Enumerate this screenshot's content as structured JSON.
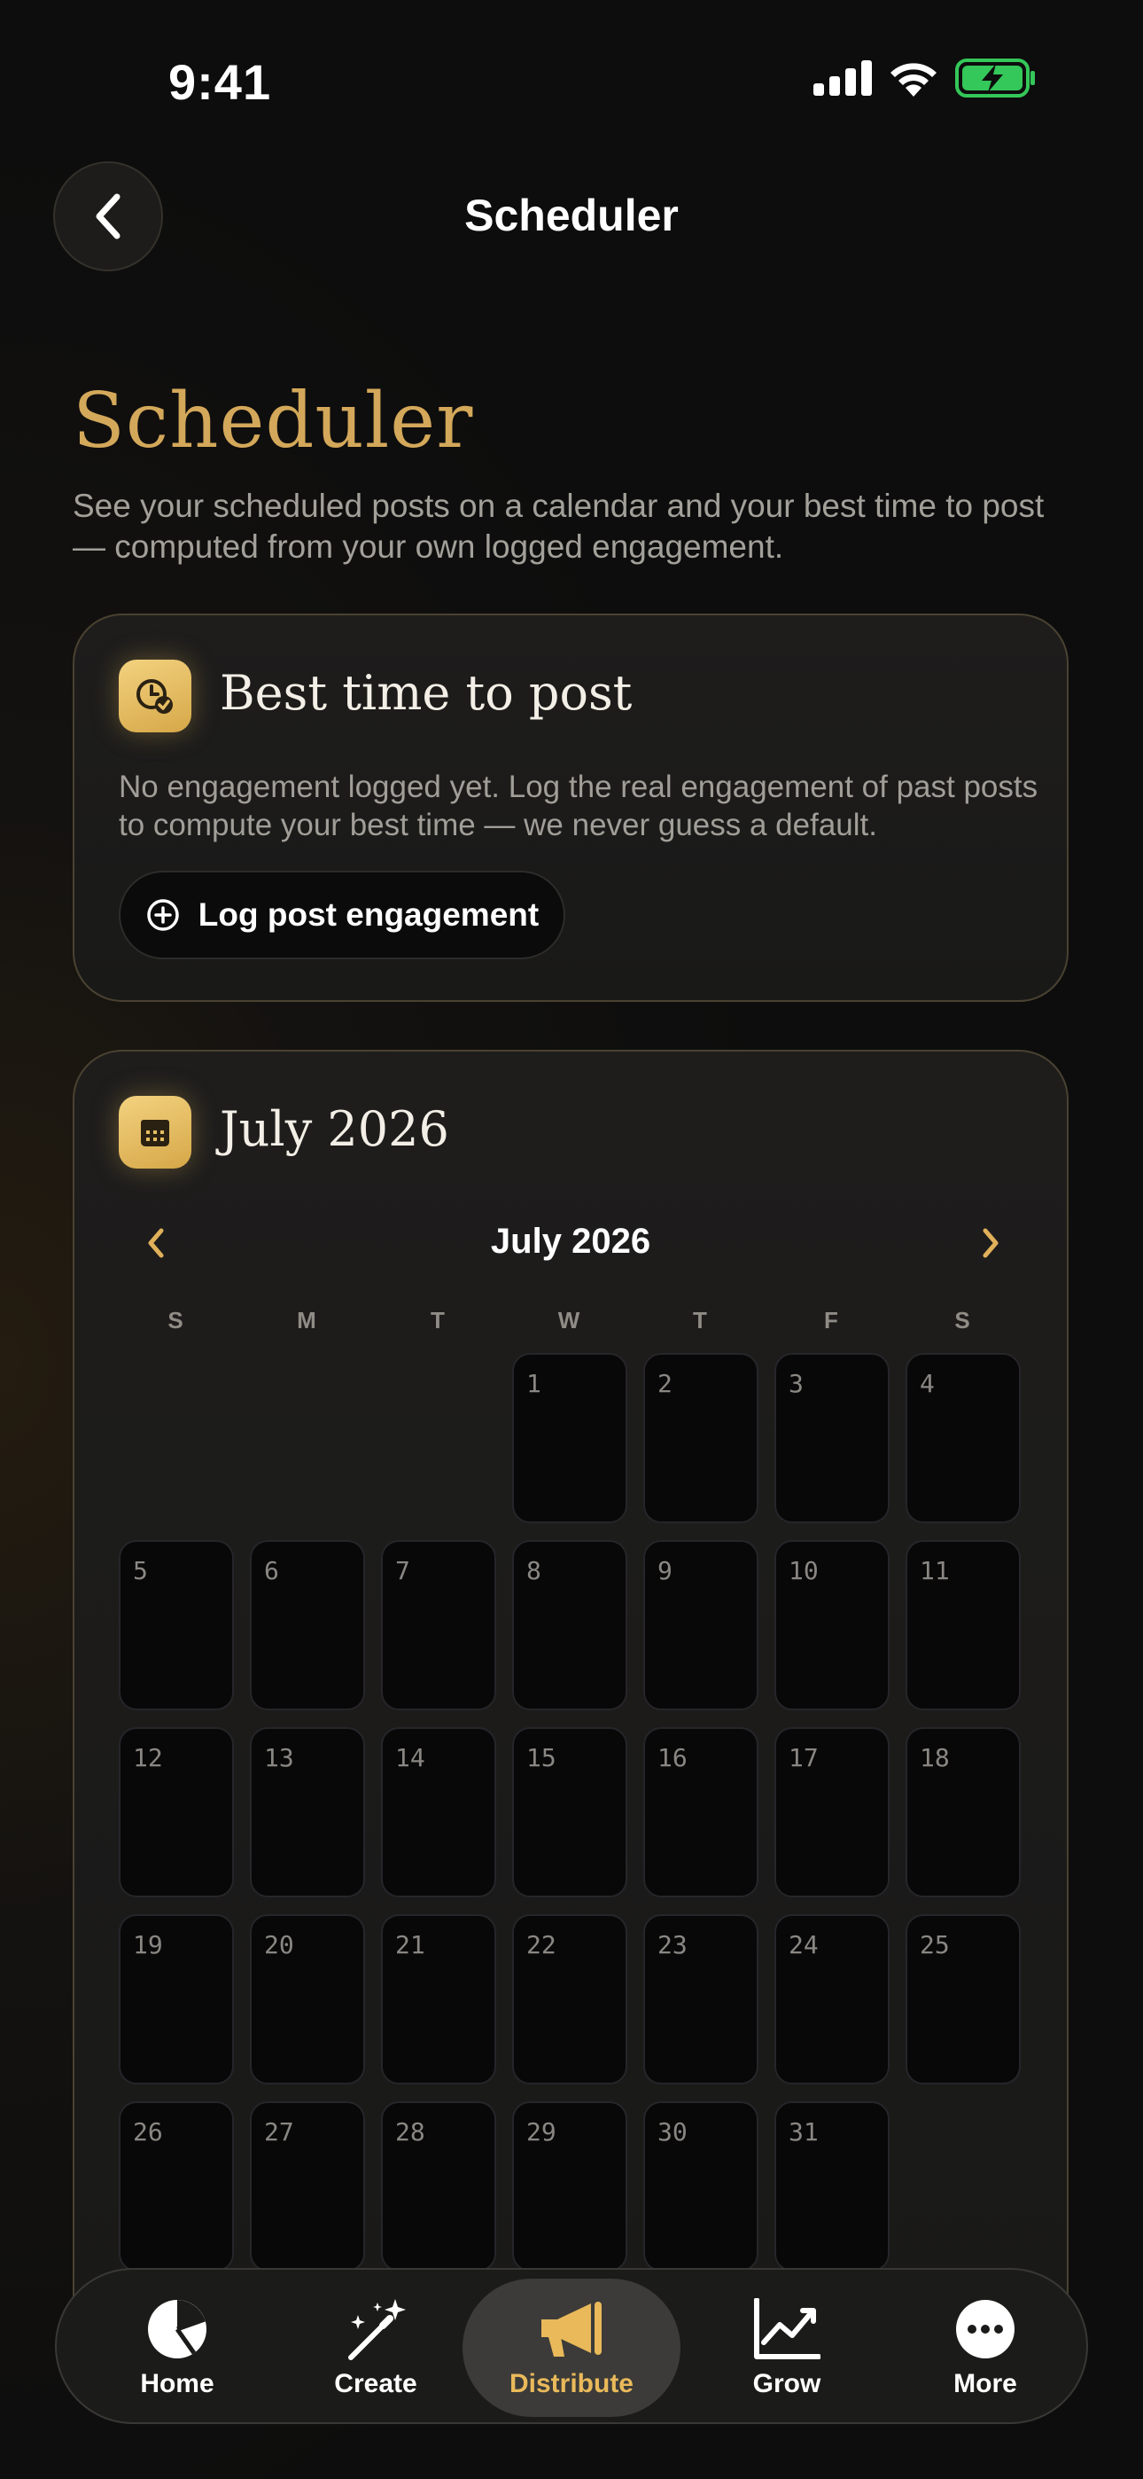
{
  "status_bar": {
    "time": "9:41"
  },
  "header": {
    "title": "Scheduler"
  },
  "page": {
    "title": "Scheduler",
    "subtitle": "See your scheduled posts on a calendar and your best time to post — computed from your own logged engagement."
  },
  "best_time_card": {
    "title": "Best time to post",
    "body": "No engagement logged yet. Log the real engagement of past posts to compute your best time — we never guess a default.",
    "button_label": "Log post engagement"
  },
  "calendar_card": {
    "title": "July 2026",
    "month_label": "July 2026",
    "weekdays": [
      "S",
      "M",
      "T",
      "W",
      "T",
      "F",
      "S"
    ],
    "first_weekday_index": 3,
    "days": [
      "1",
      "2",
      "3",
      "4",
      "5",
      "6",
      "7",
      "8",
      "9",
      "10",
      "11",
      "12",
      "13",
      "14",
      "15",
      "16",
      "17",
      "18",
      "19",
      "20",
      "21",
      "22",
      "23",
      "24",
      "25",
      "26",
      "27",
      "28",
      "29",
      "30",
      "31"
    ]
  },
  "tabbar": {
    "tabs": [
      {
        "label": "Home",
        "icon": "pie-chart-icon",
        "active": false
      },
      {
        "label": "Create",
        "icon": "magic-wand-icon",
        "active": false
      },
      {
        "label": "Distribute",
        "icon": "megaphone-icon",
        "active": true
      },
      {
        "label": "Grow",
        "icon": "trend-chart-icon",
        "active": false
      },
      {
        "label": "More",
        "icon": "more-icon",
        "active": false
      }
    ]
  },
  "colors": {
    "accent": "#d4a85a",
    "active_tab": "#e9b95a",
    "battery": "#34c759"
  }
}
